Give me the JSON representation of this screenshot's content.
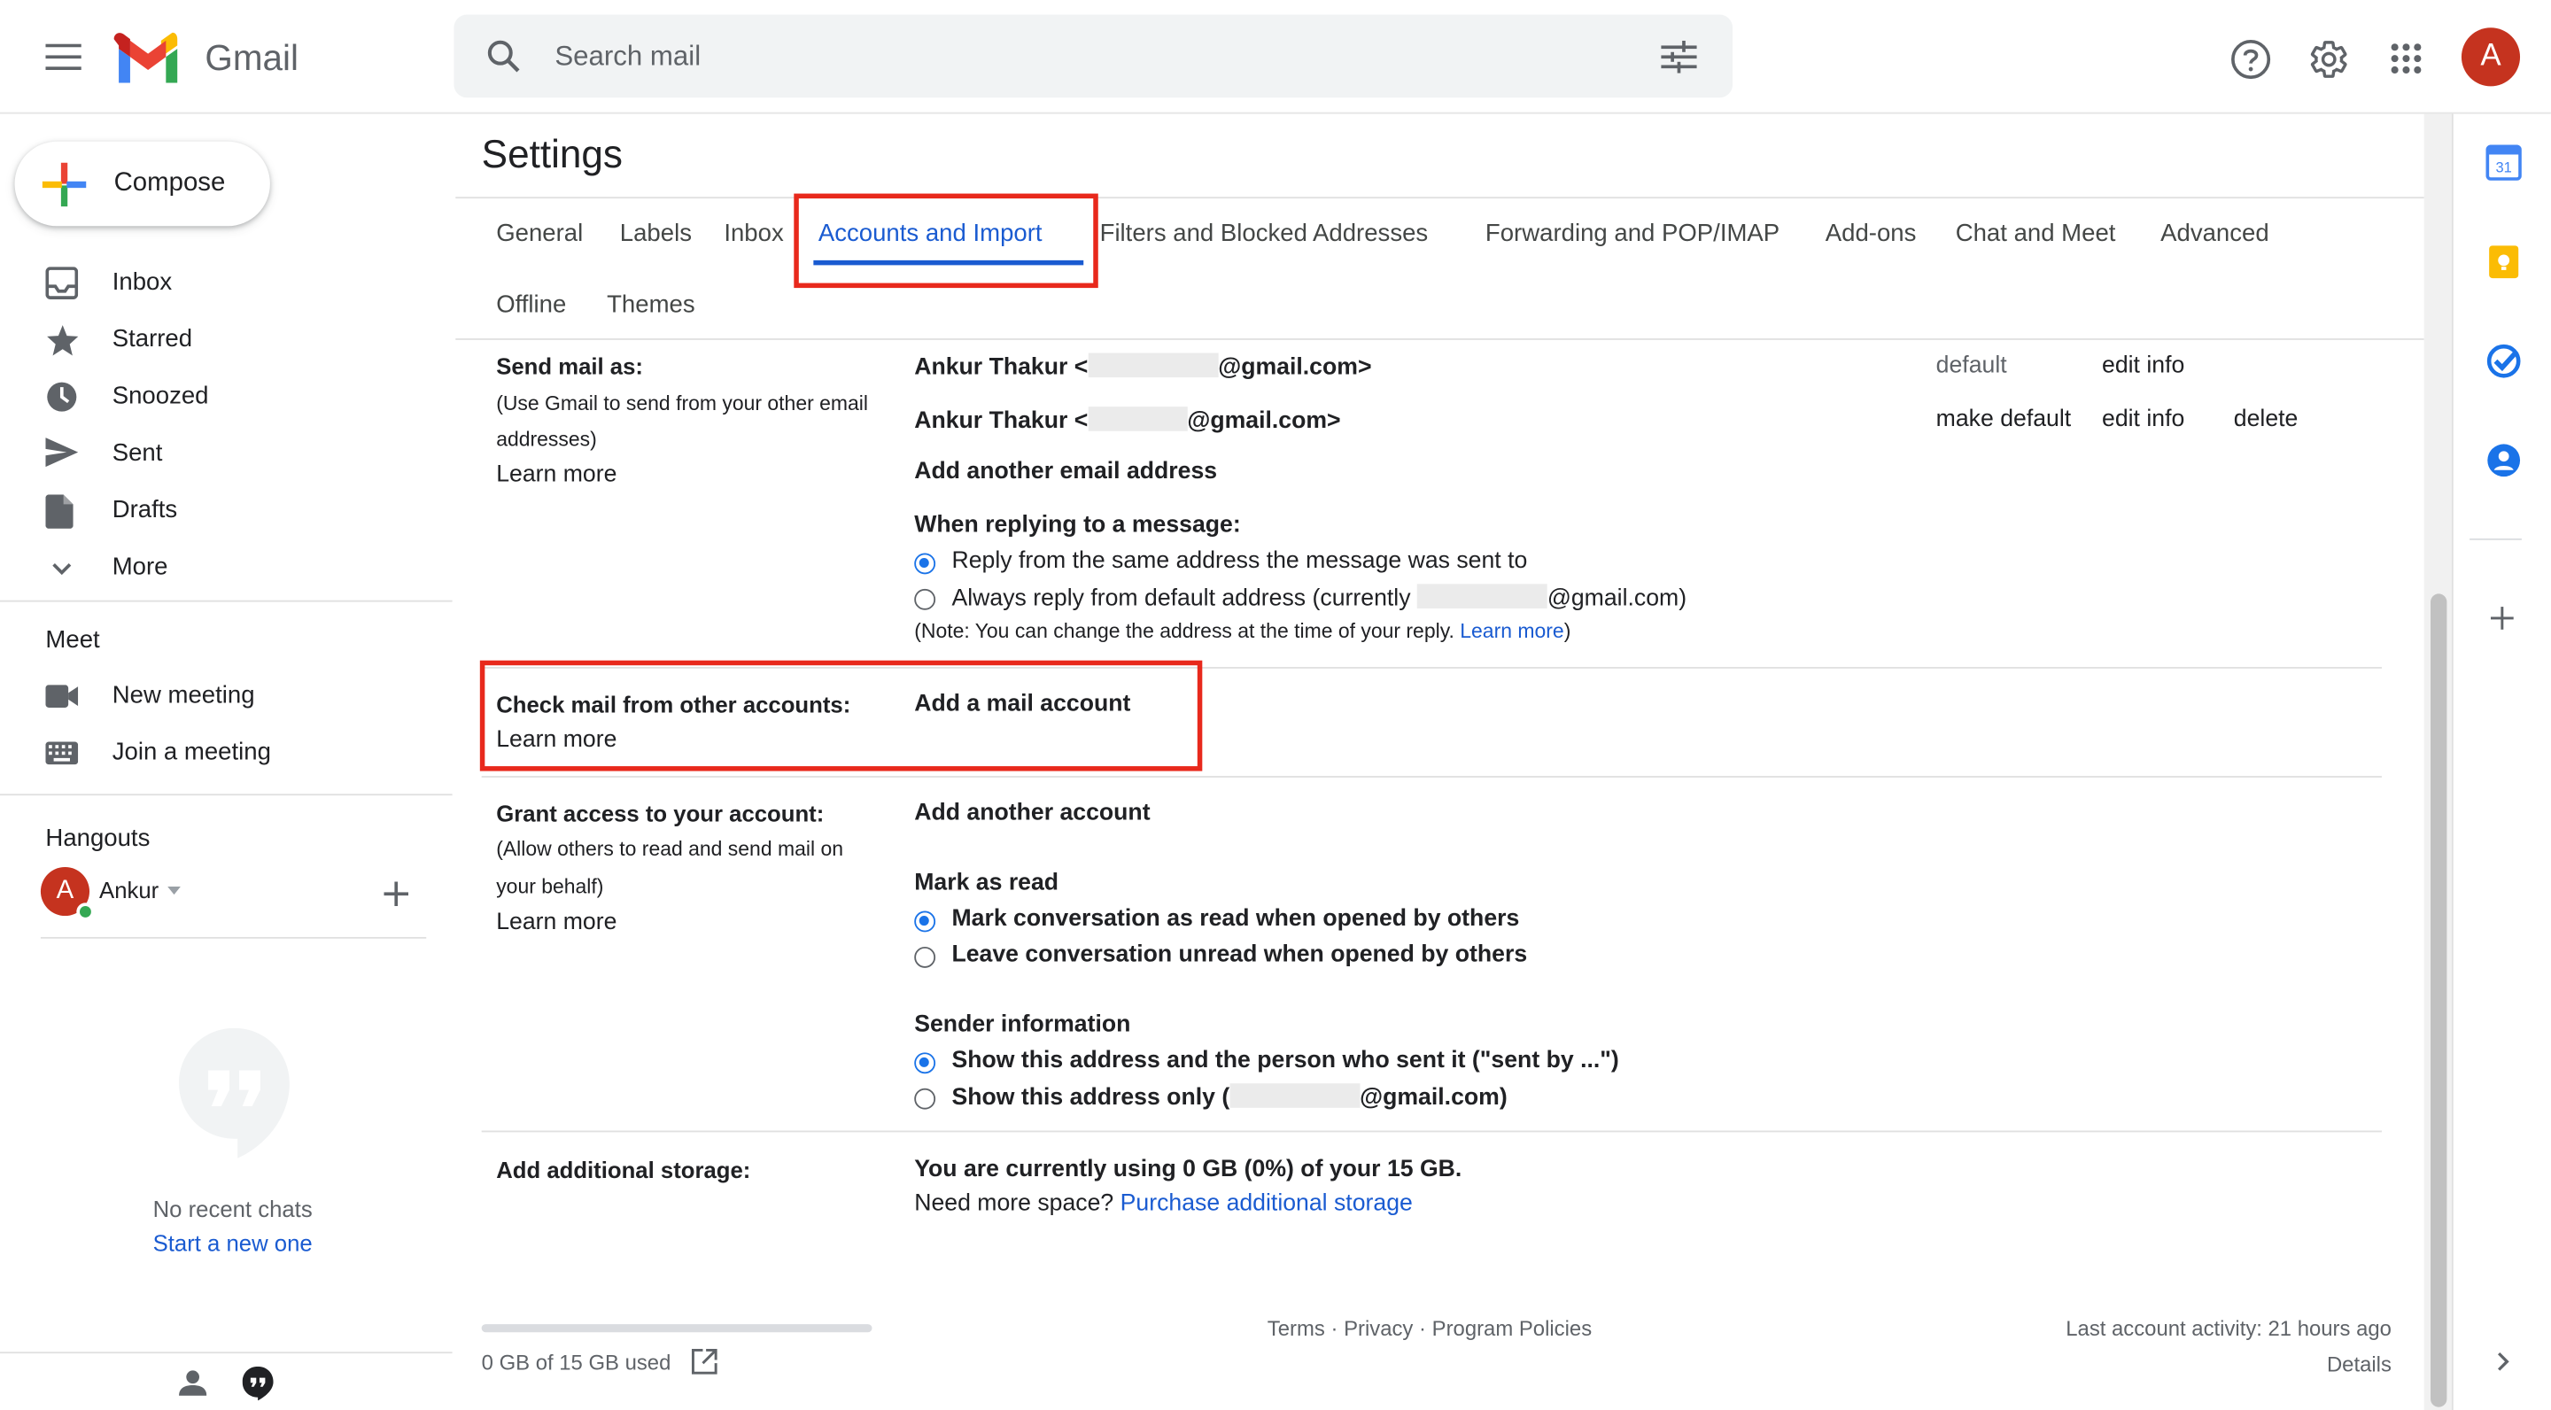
{
  "app": {
    "name": "Gmail"
  },
  "header": {
    "search_placeholder": "Search mail",
    "avatar_letter": "A",
    "brand_color": "#c5331f"
  },
  "sidebar": {
    "compose_label": "Compose",
    "nav": [
      {
        "label": "Inbox",
        "icon": "inbox-icon"
      },
      {
        "label": "Starred",
        "icon": "star-icon"
      },
      {
        "label": "Snoozed",
        "icon": "clock-icon"
      },
      {
        "label": "Sent",
        "icon": "send-icon"
      },
      {
        "label": "Drafts",
        "icon": "draft-icon"
      },
      {
        "label": "More",
        "icon": "chevron-down-icon"
      }
    ],
    "meet": {
      "title": "Meet",
      "items": [
        {
          "label": "New meeting",
          "icon": "video-icon"
        },
        {
          "label": "Join a meeting",
          "icon": "keyboard-icon"
        }
      ]
    },
    "hangouts": {
      "title": "Hangouts",
      "user": "Ankur",
      "avatar_letter": "A",
      "no_chats": "No recent chats",
      "start_new": "Start a new one"
    }
  },
  "settings": {
    "title": "Settings",
    "tabs": [
      "General",
      "Labels",
      "Inbox",
      "Accounts and Import",
      "Filters and Blocked Addresses",
      "Forwarding and POP/IMAP",
      "Add-ons",
      "Chat and Meet",
      "Advanced",
      "Offline",
      "Themes"
    ],
    "active_tab": "Accounts and Import",
    "send_mail_as": {
      "label": "Send mail as:",
      "desc_line1": "(Use Gmail to send from your other email",
      "desc_line2": "addresses)",
      "learn_more": "Learn more",
      "accounts": [
        {
          "name_prefix": "Ankur Thakur <",
          "domain_suffix": "@gmail.com>",
          "status": "default",
          "edit": "edit info",
          "make_default": "",
          "delete": ""
        },
        {
          "name_prefix": "Ankur Thakur <",
          "domain_suffix": "@gmail.com>",
          "status": "",
          "edit": "edit info",
          "make_default": "make default",
          "delete": "delete"
        }
      ],
      "add_another": "Add another email address",
      "reply_title": "When replying to a message:",
      "reply_opt1": "Reply from the same address the message was sent to",
      "reply_opt2_prefix": "Always reply from default address (currently",
      "reply_opt2_suffix": "@gmail.com)",
      "note": "(Note: You can change the address at the time of your reply.",
      "note_link": "Learn more",
      "note_end": ")"
    },
    "check_mail": {
      "label": "Check mail from other accounts:",
      "learn_more": "Learn more",
      "action": "Add a mail account"
    },
    "grant_access": {
      "label": "Grant access to your account:",
      "desc_line1": "(Allow others to read and send mail on",
      "desc_line2": "your behalf)",
      "learn_more": "Learn more",
      "action": "Add another account",
      "mark_title": "Mark as read",
      "mark_opt1": "Mark conversation as read when opened by others",
      "mark_opt2": "Leave conversation unread when opened by others",
      "sender_title": "Sender information",
      "sender_opt1": "Show this address and the person who sent it (\"sent by ...\")",
      "sender_opt2_prefix": "Show this address only (",
      "sender_opt2_suffix": "@gmail.com)"
    },
    "storage": {
      "label": "Add additional storage:",
      "usage": "You are currently using 0 GB (0%) of your 15 GB.",
      "need_more": "Need more space?",
      "purchase": "Purchase additional storage"
    }
  },
  "footer": {
    "used": "0 GB of 15 GB used",
    "used_fraction": 0.0,
    "terms": "Terms",
    "privacy": "Privacy",
    "policies": "Program Policies",
    "sep": "·",
    "activity": "Last account activity: 21 hours ago",
    "details": "Details"
  },
  "right_panel": {
    "calendar_day": "31"
  },
  "colors": {
    "link": "#1a5bd1",
    "highlight_box": "#e8291c",
    "radio_selected": "#1a73e8"
  }
}
